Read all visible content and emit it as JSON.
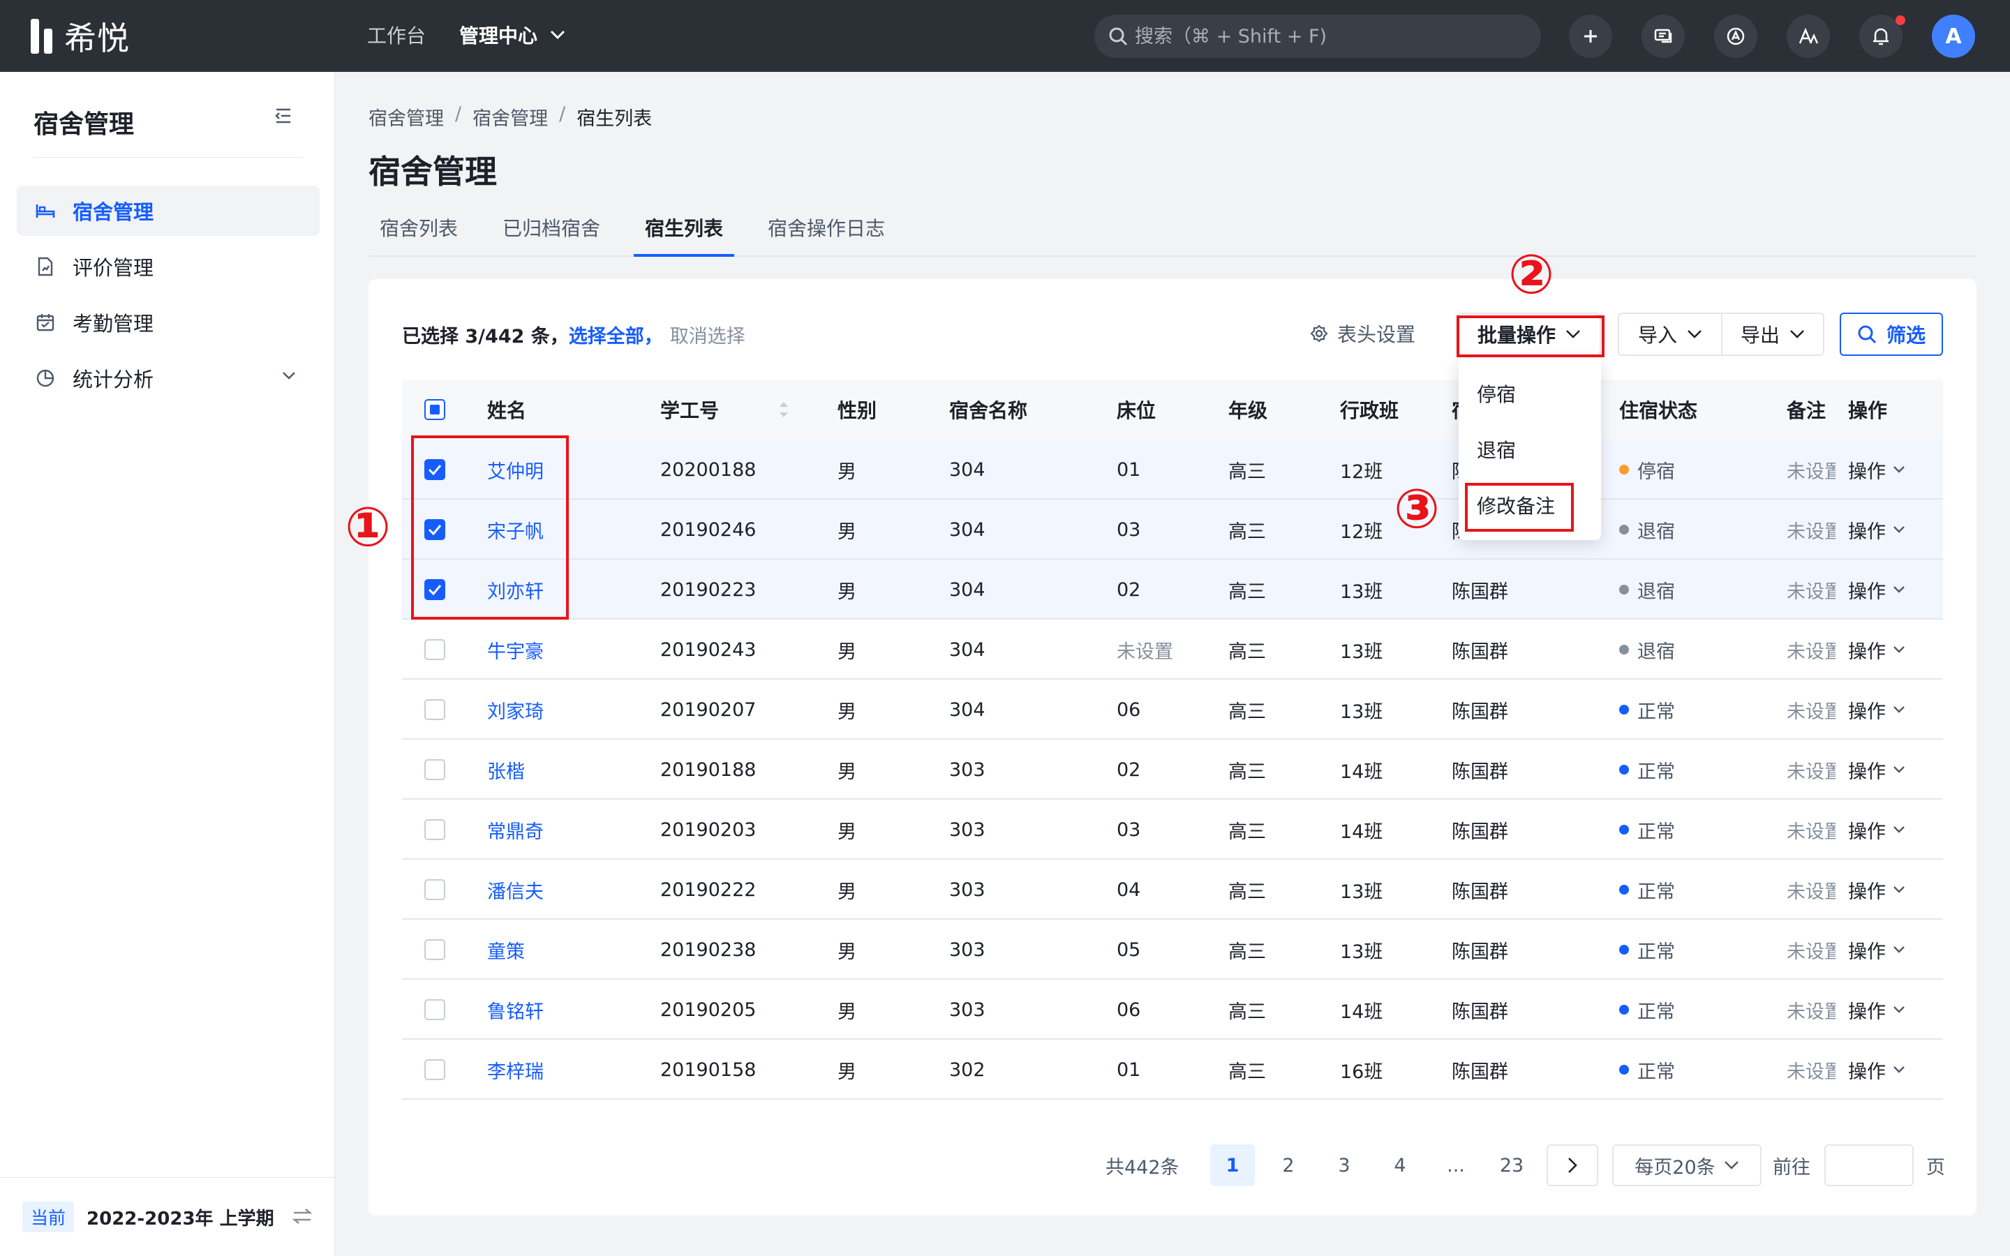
{
  "topbar": {
    "logo_text": "希悦",
    "nav_workbench": "工作台",
    "nav_admin": "管理中心",
    "search_placeholder": "搜索（⌘ + Shift + F)",
    "avatar_letter": "A"
  },
  "sidebar": {
    "title": "宿舍管理",
    "items": [
      {
        "label": "宿舍管理",
        "icon": "bed-icon"
      },
      {
        "label": "评价管理",
        "icon": "evaluation-icon"
      },
      {
        "label": "考勤管理",
        "icon": "calendar-icon"
      },
      {
        "label": "统计分析",
        "icon": "pie-chart-icon"
      }
    ],
    "term_badge": "当前",
    "term_label": "2022-2023年 上学期"
  },
  "breadcrumb": [
    "宿舍管理",
    "宿舍管理",
    "宿生列表"
  ],
  "page_title": "宿舍管理",
  "tabs": [
    "宿舍列表",
    "已归档宿舍",
    "宿生列表",
    "宿舍操作日志"
  ],
  "toolbar": {
    "selected_count": "已选择 3/442 条，",
    "select_all": "选择全部，",
    "cancel_select": "取消选择",
    "column_settings": "表头设置",
    "batch": "批量操作",
    "import": "导入",
    "export": "导出",
    "filter": "筛选"
  },
  "batch_menu": [
    "停宿",
    "退宿",
    "修改备注"
  ],
  "table": {
    "headers": {
      "name": "姓名",
      "id": "学工号",
      "sex": "性别",
      "dorm": "宿舍名称",
      "bed": "床位",
      "grade": "年级",
      "class": "行政班",
      "teacher": "宿",
      "status": "住宿状态",
      "note": "备注",
      "op": "操作"
    },
    "rows": [
      {
        "name": "艾仲明",
        "id": "20200188",
        "sex": "男",
        "dorm": "304",
        "bed": "01",
        "grade": "高三",
        "class": "12班",
        "teacher": "陈国群",
        "status": "停宿",
        "note": "未设置",
        "op": "操作",
        "checked": true
      },
      {
        "name": "宋子帆",
        "id": "20190246",
        "sex": "男",
        "dorm": "304",
        "bed": "03",
        "grade": "高三",
        "class": "12班",
        "teacher": "陈国群",
        "status": "退宿",
        "note": "未设置",
        "op": "操作",
        "checked": true
      },
      {
        "name": "刘亦轩",
        "id": "20190223",
        "sex": "男",
        "dorm": "304",
        "bed": "02",
        "grade": "高三",
        "class": "13班",
        "teacher": "陈国群",
        "status": "退宿",
        "note": "未设置",
        "op": "操作",
        "checked": true
      },
      {
        "name": "牛宇豪",
        "id": "20190243",
        "sex": "男",
        "dorm": "304",
        "bed": "未设置",
        "grade": "高三",
        "class": "13班",
        "teacher": "陈国群",
        "status": "退宿",
        "note": "未设置",
        "op": "操作",
        "checked": false
      },
      {
        "name": "刘家琦",
        "id": "20190207",
        "sex": "男",
        "dorm": "304",
        "bed": "06",
        "grade": "高三",
        "class": "13班",
        "teacher": "陈国群",
        "status": "正常",
        "note": "未设置",
        "op": "操作",
        "checked": false
      },
      {
        "name": "张楷",
        "id": "20190188",
        "sex": "男",
        "dorm": "303",
        "bed": "02",
        "grade": "高三",
        "class": "14班",
        "teacher": "陈国群",
        "status": "正常",
        "note": "未设置",
        "op": "操作",
        "checked": false
      },
      {
        "name": "常鼎奇",
        "id": "20190203",
        "sex": "男",
        "dorm": "303",
        "bed": "03",
        "grade": "高三",
        "class": "14班",
        "teacher": "陈国群",
        "status": "正常",
        "note": "未设置",
        "op": "操作",
        "checked": false
      },
      {
        "name": "潘信夫",
        "id": "20190222",
        "sex": "男",
        "dorm": "303",
        "bed": "04",
        "grade": "高三",
        "class": "13班",
        "teacher": "陈国群",
        "status": "正常",
        "note": "未设置",
        "op": "操作",
        "checked": false
      },
      {
        "name": "童策",
        "id": "20190238",
        "sex": "男",
        "dorm": "303",
        "bed": "05",
        "grade": "高三",
        "class": "13班",
        "teacher": "陈国群",
        "status": "正常",
        "note": "未设置",
        "op": "操作",
        "checked": false
      },
      {
        "name": "鲁铭轩",
        "id": "20190205",
        "sex": "男",
        "dorm": "303",
        "bed": "06",
        "grade": "高三",
        "class": "14班",
        "teacher": "陈国群",
        "status": "正常",
        "note": "未设置",
        "op": "操作",
        "checked": false
      },
      {
        "name": "李梓瑞",
        "id": "20190158",
        "sex": "男",
        "dorm": "302",
        "bed": "01",
        "grade": "高三",
        "class": "16班",
        "teacher": "陈国群",
        "status": "正常",
        "note": "未设置",
        "op": "操作",
        "checked": false
      }
    ],
    "status_colors": {
      "停宿": "#ff9a2e",
      "退宿": "#86909c",
      "正常": "#165dff"
    }
  },
  "pagination": {
    "total": "共442条",
    "pages": [
      "1",
      "2",
      "3",
      "4",
      "...",
      "23"
    ],
    "page_size": "每页20条",
    "goto": "前往",
    "unit": "页"
  },
  "annotations": [
    "①",
    "②",
    "③"
  ],
  "colors": {
    "accent": "#165dff",
    "annotation": "#e8131b",
    "topbar": "#2b2f36"
  }
}
